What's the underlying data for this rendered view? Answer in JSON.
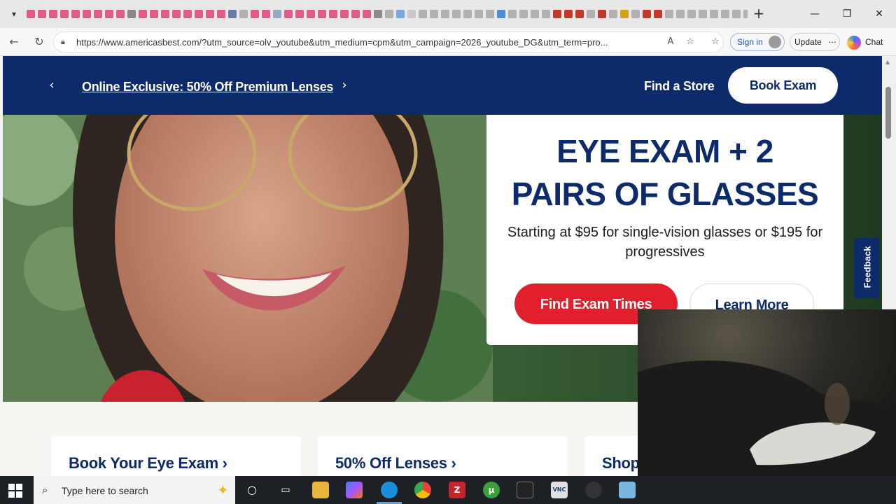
{
  "browser": {
    "tab_colors": [
      "#e05b8a",
      "#e05b8a",
      "#e05b8a",
      "#e05b8a",
      "#e05b8a",
      "#e05b8a",
      "#e05b8a",
      "#e05b8a",
      "#e05b8a",
      "#888888",
      "#e05b8a",
      "#e05b8a",
      "#e05b8a",
      "#e05b8a",
      "#e05b8a",
      "#e05b8a",
      "#e05b8a",
      "#e05b8a",
      "#6b7ba8",
      "#b0b0b0",
      "#e05b8a",
      "#e05b8a",
      "#9aa7c7",
      "#e05b8a",
      "#e05b8a",
      "#e05b8a",
      "#e05b8a",
      "#e05b8a",
      "#e05b8a",
      "#e05b8a",
      "#e05b8a",
      "#8a8a8a",
      "#b0b0b0",
      "#7aa7e0",
      "#c8c8c8",
      "#b0b0b0",
      "#b0b0b0",
      "#b0b0b0",
      "#b0b0b0",
      "#b0b0b0",
      "#b0b0b0",
      "#b0b0b0",
      "#4a90d9",
      "#b0b0b0",
      "#b0b0b0",
      "#b0b0b0",
      "#b0b0b0",
      "#c0392b",
      "#c0392b",
      "#c0392b",
      "#b0b0b0",
      "#c0392b",
      "#b0b0b0",
      "#d4a017",
      "#b0b0b0",
      "#c0392b",
      "#c0392b",
      "#b0b0b0",
      "#b0b0b0",
      "#b0b0b0",
      "#b0b0b0",
      "#b0b0b0",
      "#b0b0b0",
      "#b0b0b0",
      "#b0b0b0",
      "#b0b0b0",
      "#7ab6e0",
      "#b0b0b0",
      "#555555",
      "#555555",
      "#555555",
      "#3aa03a"
    ],
    "url": "https://www.americasbest.com/?utm_source=olv_youtube&utm_medium=cpm&utm_campaign=2026_youtube_DG&utm_term=pro...",
    "signin_label": "Sign in",
    "update_label": "Update",
    "chat_label": "Chat"
  },
  "promo": {
    "text": "Online Exclusive: 50% Off Premium Lenses",
    "find_store": "Find a Store",
    "book_exam": "Book Exam"
  },
  "hero": {
    "title_line1": "EYE EXAM + 2",
    "title_line2": "PAIRS OF GLASSES",
    "subtitle": "Starting at $95 for single-vision glasses or $195 for progressives",
    "primary_cta": "Find Exam Times",
    "secondary_cta": "Learn More"
  },
  "feedback_label": "Feedback",
  "tiles": [
    "Book Your Eye Exam ›",
    "50% Off Lenses ›",
    "Shop"
  ],
  "taskbar": {
    "search_placeholder": "Type here to search"
  },
  "colors": {
    "brand_navy": "#0d2a6b",
    "cta_red": "#e21f2d"
  }
}
